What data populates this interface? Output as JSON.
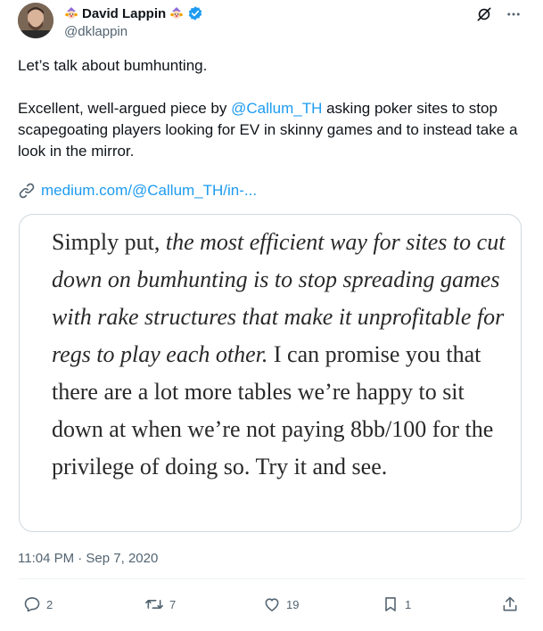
{
  "author": {
    "name": "David Lappin",
    "handle": "@dklappin",
    "verified": true,
    "name_emoji_icon": "clown-emoji-icon"
  },
  "tweet": {
    "line1": "Let’s talk about bumhunting.",
    "para2_before": "Excellent, well-argued piece by ",
    "mention": "@Callum_TH",
    "para2_after": " asking poker sites to stop scapegoating players looking for EV in skinny games and to instead take a look in the mirror.",
    "link_text": "medium.com/@Callum_TH/in-..."
  },
  "card": {
    "quote_plain1": "Simply put, ",
    "quote_italic": "the most efficient way for sites to cut down on bumhunting is to stop spreading games with rake structures that make it unprofitable for regs to play each other.",
    "quote_plain2": " I can promise you that there are a lot more tables we’re happy to sit down at when we’re not paying 8bb/100 for the privilege of doing so. Try it and see."
  },
  "timestamp": "11:04 PM · Sep 7, 2020",
  "actions": {
    "replies": "2",
    "retweets": "7",
    "likes": "19",
    "bookmarks": "1"
  },
  "colors": {
    "link": "#1d9bf0",
    "muted": "#536471",
    "verified": "#1d9bf0"
  }
}
